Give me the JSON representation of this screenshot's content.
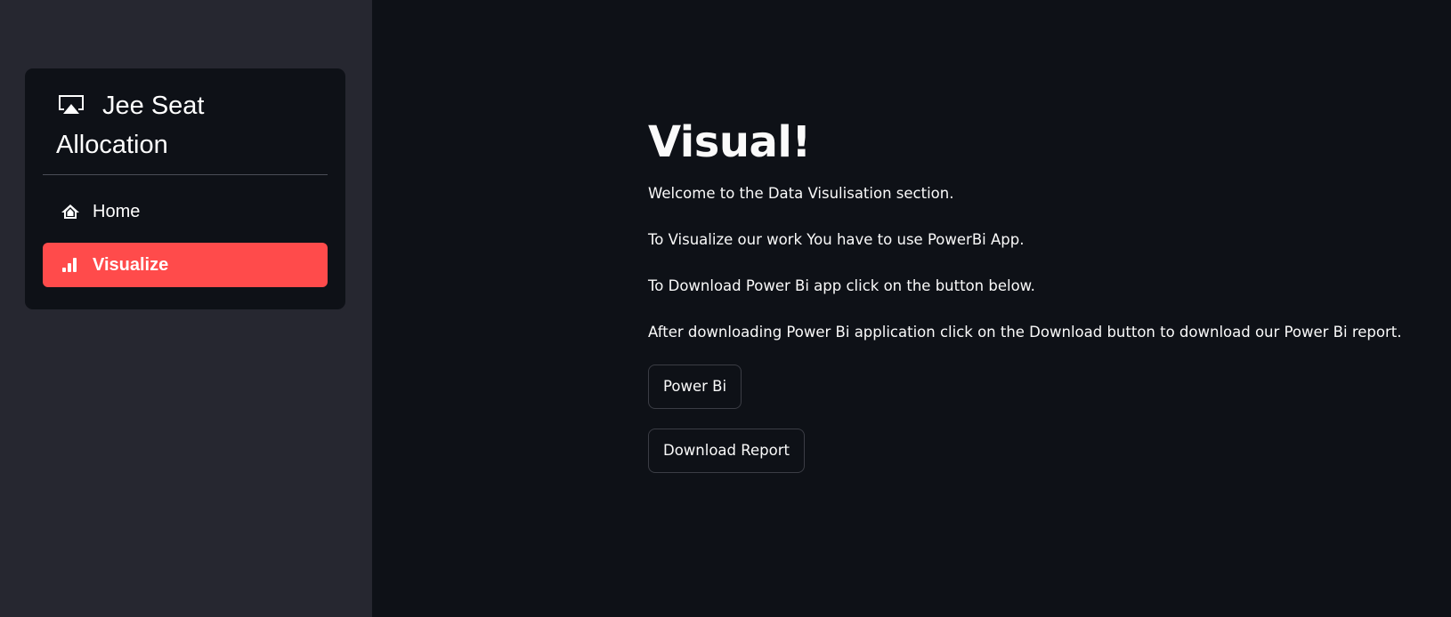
{
  "sidebar": {
    "title_line1": "Jee Seat",
    "title_line2": "Allocation",
    "title_icon": "cast-icon",
    "items": [
      {
        "label": "Home",
        "icon": "home-icon",
        "active": false
      },
      {
        "label": "Visualize",
        "icon": "bar-chart-icon",
        "active": true
      }
    ],
    "active_color": "#ff4b4b"
  },
  "main": {
    "title": "Visual!",
    "paragraphs": [
      "Welcome to the Data Visulisation section.",
      "To Visualize our work You have to use PowerBi App.",
      "To Download Power Bi app click on the button below.",
      "After downloading Power Bi application click on the Download button to download our Power Bi report."
    ],
    "buttons": {
      "powerbi_label": "Power Bi",
      "download_label": "Download Report"
    }
  }
}
